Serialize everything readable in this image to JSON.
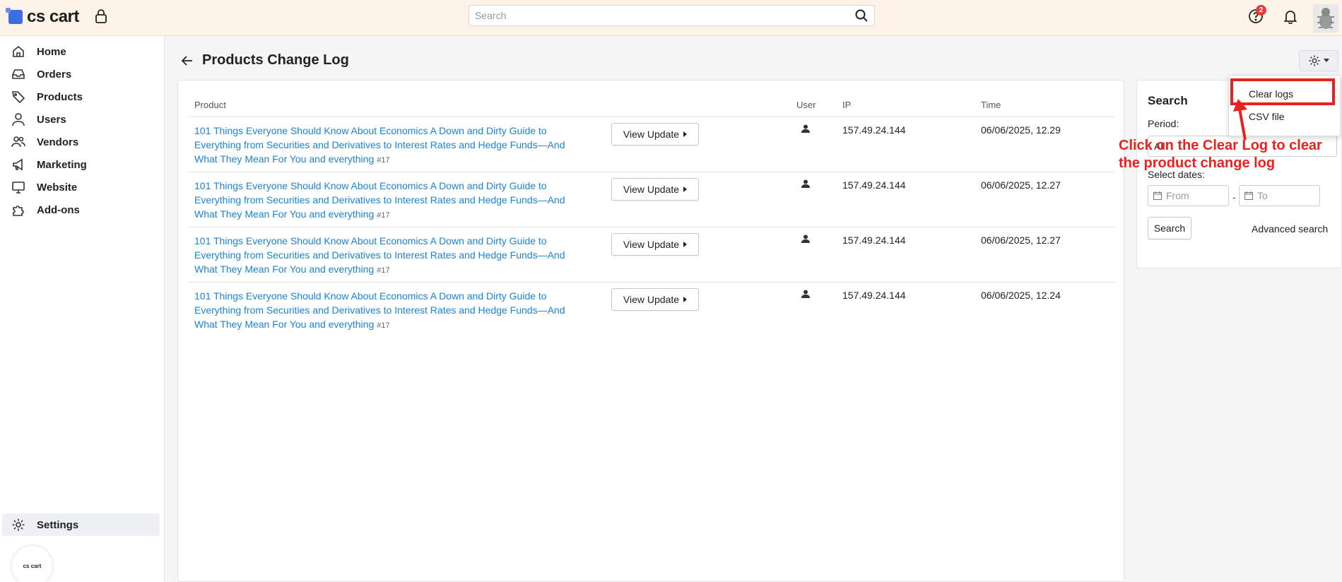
{
  "app": {
    "logo_text": "cs cart",
    "mini_logo_text": "cs cart"
  },
  "topbar": {
    "search_placeholder": "Search",
    "help_badge": "2"
  },
  "sidebar": {
    "items": [
      {
        "label": "Home",
        "icon": "home-icon"
      },
      {
        "label": "Orders",
        "icon": "inbox-icon"
      },
      {
        "label": "Products",
        "icon": "tag-icon"
      },
      {
        "label": "Users",
        "icon": "user-icon"
      },
      {
        "label": "Vendors",
        "icon": "vendors-icon"
      },
      {
        "label": "Marketing",
        "icon": "megaphone-icon"
      },
      {
        "label": "Website",
        "icon": "monitor-icon"
      },
      {
        "label": "Add-ons",
        "icon": "puzzle-icon"
      }
    ],
    "settings_label": "Settings"
  },
  "page": {
    "title": "Products Change Log"
  },
  "table": {
    "headers": {
      "product": "Product",
      "user": "User",
      "ip": "IP",
      "time": "Time"
    },
    "view_label": "View Update",
    "rows": [
      {
        "product": "101 Things Everyone Should Know About Economics A Down and Dirty Guide to Everything from Securities and Derivatives to Interest Rates and Hedge Funds—And What They Mean For You and everything",
        "id": "#17",
        "ip": "157.49.24.144",
        "time": "06/06/2025, 12.29"
      },
      {
        "product": "101 Things Everyone Should Know About Economics A Down and Dirty Guide to Everything from Securities and Derivatives to Interest Rates and Hedge Funds—And What They Mean For You and everything",
        "id": "#17",
        "ip": "157.49.24.144",
        "time": "06/06/2025, 12.27"
      },
      {
        "product": "101 Things Everyone Should Know About Economics A Down and Dirty Guide to Everything from Securities and Derivatives to Interest Rates and Hedge Funds—And What They Mean For You and everything",
        "id": "#17",
        "ip": "157.49.24.144",
        "time": "06/06/2025, 12.27"
      },
      {
        "product": "101 Things Everyone Should Know About Economics A Down and Dirty Guide to Everything from Securities and Derivatives to Interest Rates and Hedge Funds—And What They Mean For You and everything",
        "id": "#17",
        "ip": "157.49.24.144",
        "time": "06/06/2025, 12.24"
      }
    ]
  },
  "search_panel": {
    "title": "Search",
    "period_label": "Period:",
    "period_value": "All",
    "dates_label": "Select dates:",
    "from_placeholder": "From",
    "to_placeholder": "To",
    "search_button": "Search",
    "advanced_link": "Advanced search"
  },
  "dropdown": {
    "items": [
      "Clear logs",
      "CSV file"
    ]
  },
  "annotation": {
    "text": "Click on the Clear Log to clear the product change log"
  },
  "colors": {
    "accent_link": "#1b84d5",
    "annotation_red": "#e8231f",
    "topbar_bg": "#fdf4e7"
  }
}
